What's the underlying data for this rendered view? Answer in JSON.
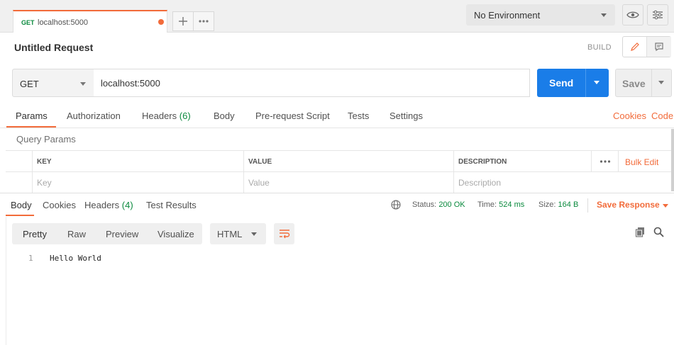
{
  "tab": {
    "method": "GET",
    "name": "localhost:5000"
  },
  "environment": {
    "selected": "No Environment"
  },
  "request": {
    "title": "Untitled Request",
    "build_label": "BUILD",
    "method": "GET",
    "url": "localhost:5000",
    "send_label": "Send",
    "save_label": "Save"
  },
  "request_tabs": {
    "params": "Params",
    "authorization": "Authorization",
    "headers": "Headers",
    "headers_count": "(6)",
    "body": "Body",
    "prerequest": "Pre-request Script",
    "tests": "Tests",
    "settings": "Settings",
    "cookies": "Cookies",
    "code": "Code"
  },
  "query_params": {
    "title": "Query Params",
    "columns": {
      "key": "KEY",
      "value": "VALUE",
      "description": "DESCRIPTION"
    },
    "placeholders": {
      "key": "Key",
      "value": "Value",
      "description": "Description"
    },
    "bulk_edit": "Bulk Edit"
  },
  "response": {
    "tabs": {
      "body": "Body",
      "cookies": "Cookies",
      "headers": "Headers",
      "headers_count": "(4)",
      "test_results": "Test Results"
    },
    "status_label": "Status:",
    "status_value": "200 OK",
    "time_label": "Time:",
    "time_value": "524 ms",
    "size_label": "Size:",
    "size_value": "164 B",
    "save_response": "Save Response",
    "formats": {
      "pretty": "Pretty",
      "raw": "Raw",
      "preview": "Preview",
      "visualize": "Visualize"
    },
    "language": "HTML",
    "lines": [
      {
        "num": "1",
        "text": "Hello World"
      }
    ]
  },
  "colors": {
    "accent": "#f26b3a",
    "send": "#1a7de8",
    "success": "#0b8a3e"
  }
}
